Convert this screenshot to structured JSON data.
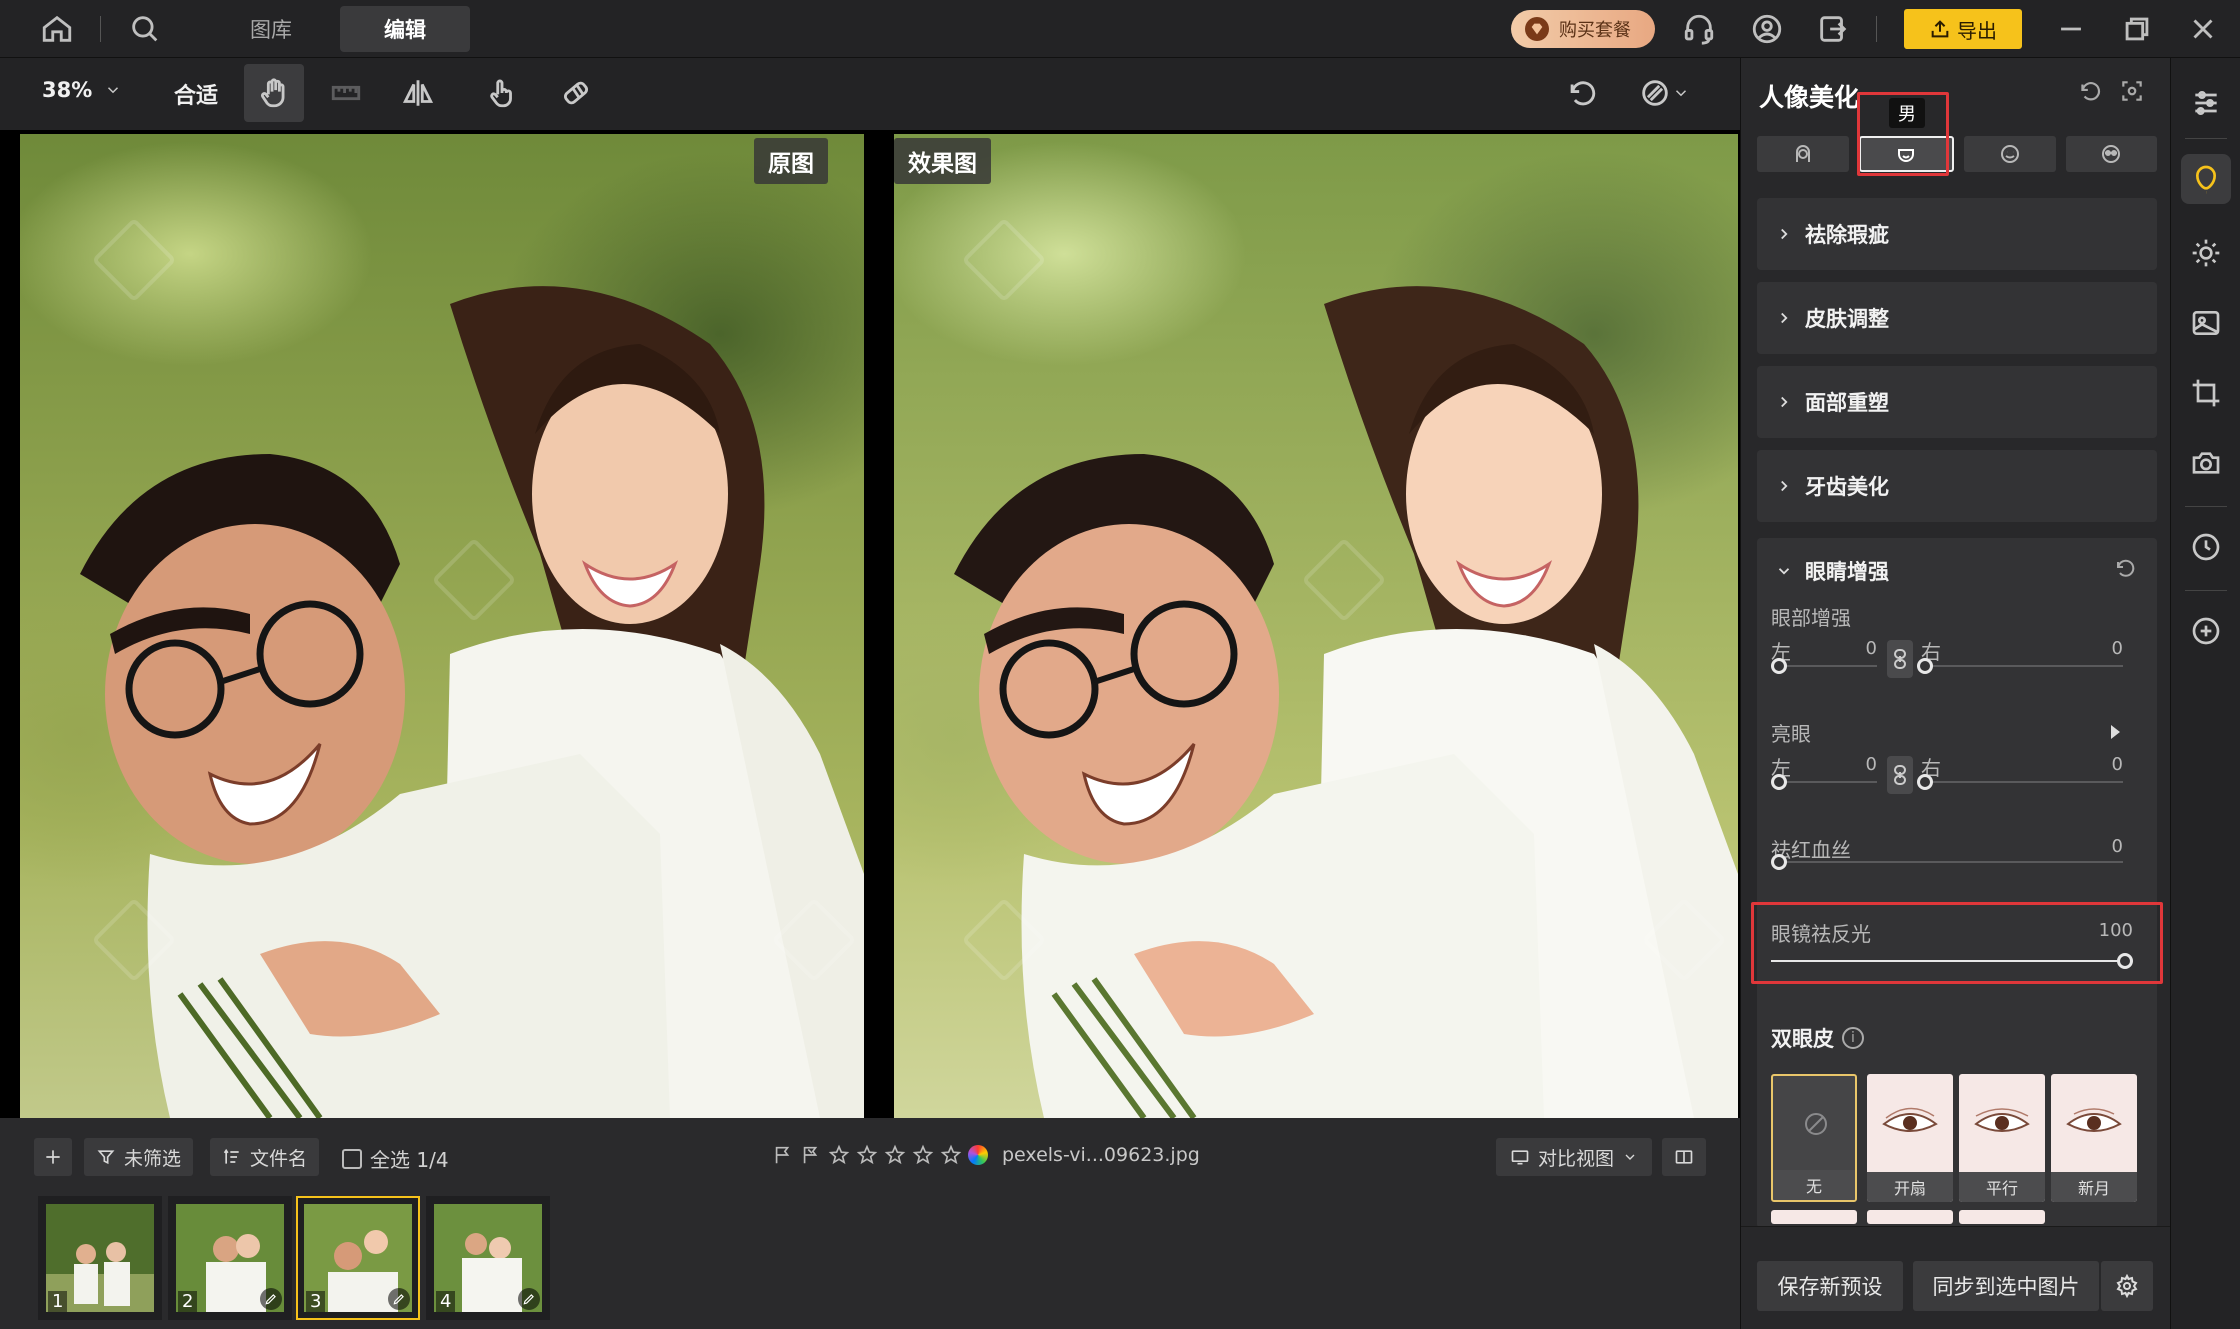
{
  "topbar": {
    "tabs": [
      {
        "label": "图库"
      },
      {
        "label": "编辑"
      }
    ],
    "buy_package": "购买套餐",
    "export": "导出"
  },
  "toolbar": {
    "zoom": "38%",
    "fit": "合适"
  },
  "canvas": {
    "original_label": "原图",
    "effect_label": "效果图"
  },
  "filmstrip": {
    "filter": "未筛选",
    "sort": "文件名",
    "select_all": "全选 1/4",
    "filename": "pexels-vi...09623.jpg",
    "compare": "对比视图",
    "thumbs": [
      {
        "num": "1"
      },
      {
        "num": "2"
      },
      {
        "num": "3"
      },
      {
        "num": "4"
      }
    ]
  },
  "panel": {
    "title": "人像美化",
    "tooltip": "男",
    "sections": [
      {
        "label": "祛除瑕疵"
      },
      {
        "label": "皮肤调整"
      },
      {
        "label": "面部重塑"
      },
      {
        "label": "牙齿美化"
      }
    ],
    "eye": {
      "title": "眼睛增强",
      "enhance_label": "眼部增强",
      "left": "左",
      "right": "右",
      "left_value": "0",
      "right_value": "0",
      "bright_label": "亮眼",
      "bright_left_value": "0",
      "bright_right_value": "0",
      "redness_label": "祛红血丝",
      "redness_value": "0",
      "glasses_label": "眼镜祛反光",
      "glasses_value": "100",
      "double_title": "双眼皮",
      "double_options": [
        {
          "label": "无"
        },
        {
          "label": "开扇"
        },
        {
          "label": "平行"
        },
        {
          "label": "新月"
        }
      ]
    },
    "footer": {
      "save_preset": "保存新预设",
      "sync": "同步到选中图片"
    }
  },
  "colors": {
    "accent": "#f6c21b",
    "highlight": "#e0373a"
  }
}
